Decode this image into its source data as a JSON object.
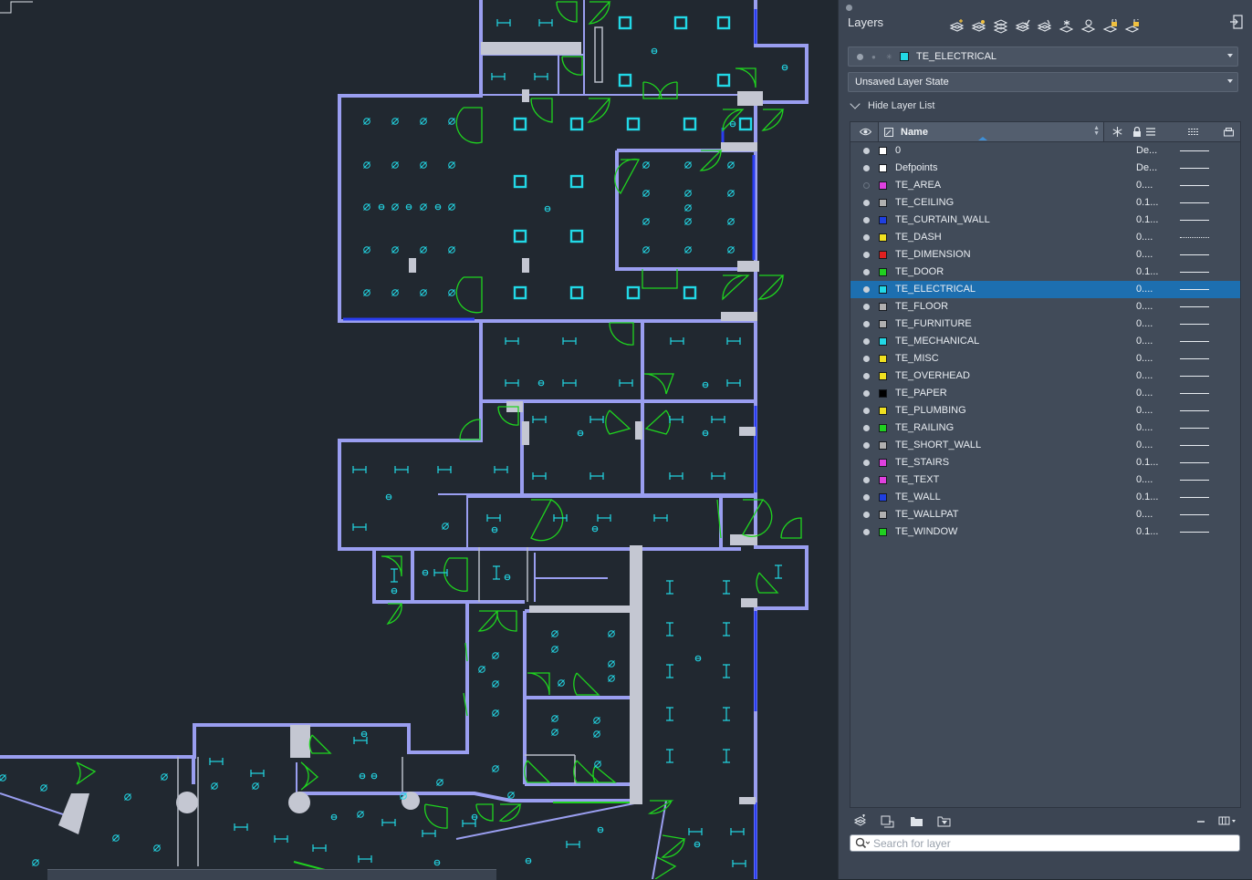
{
  "panel": {
    "title": "Layers",
    "current_layer": {
      "name": "TE_ELECTRICAL",
      "color": "#22d8e6"
    },
    "layer_state": "Unsaved Layer State",
    "hide_list_label": "Hide Layer List",
    "column_name": "Name",
    "search_placeholder": "Search for layer"
  },
  "layers": [
    {
      "name": "0",
      "color": "#ffffff",
      "lineweight": "De...",
      "on": true,
      "linetype": "solid",
      "selected": false
    },
    {
      "name": "Defpoints",
      "color": "#ffffff",
      "lineweight": "De...",
      "on": true,
      "linetype": "solid",
      "selected": false
    },
    {
      "name": "TE_AREA",
      "color": "#e040e0",
      "lineweight": "0....",
      "on": false,
      "linetype": "solid",
      "selected": false
    },
    {
      "name": "TE_CEILING",
      "color": "#b0b0b0",
      "lineweight": "0.1...",
      "on": true,
      "linetype": "solid",
      "selected": false
    },
    {
      "name": "TE_CURTAIN_WALL",
      "color": "#1f3fe0",
      "lineweight": "0.1...",
      "on": true,
      "linetype": "solid",
      "selected": false
    },
    {
      "name": "TE_DASH",
      "color": "#f0e020",
      "lineweight": "0....",
      "on": true,
      "linetype": "dashed",
      "selected": false
    },
    {
      "name": "TE_DIMENSION",
      "color": "#e02020",
      "lineweight": "0....",
      "on": true,
      "linetype": "solid",
      "selected": false
    },
    {
      "name": "TE_DOOR",
      "color": "#20d020",
      "lineweight": "0.1...",
      "on": true,
      "linetype": "solid",
      "selected": false
    },
    {
      "name": "TE_ELECTRICAL",
      "color": "#22d8e6",
      "lineweight": "0....",
      "on": true,
      "linetype": "solid",
      "selected": true
    },
    {
      "name": "TE_FLOOR",
      "color": "#b0b0b0",
      "lineweight": "0....",
      "on": true,
      "linetype": "solid",
      "selected": false
    },
    {
      "name": "TE_FURNITURE",
      "color": "#b0b0b0",
      "lineweight": "0....",
      "on": true,
      "linetype": "solid",
      "selected": false
    },
    {
      "name": "TE_MECHANICAL",
      "color": "#22d8e6",
      "lineweight": "0....",
      "on": true,
      "linetype": "solid",
      "selected": false
    },
    {
      "name": "TE_MISC",
      "color": "#f0e020",
      "lineweight": "0....",
      "on": true,
      "linetype": "solid",
      "selected": false
    },
    {
      "name": "TE_OVERHEAD",
      "color": "#f0e020",
      "lineweight": "0....",
      "on": true,
      "linetype": "solid",
      "selected": false
    },
    {
      "name": "TE_PAPER",
      "color": "#000000",
      "lineweight": "0....",
      "on": true,
      "linetype": "solid",
      "selected": false
    },
    {
      "name": "TE_PLUMBING",
      "color": "#f0e020",
      "lineweight": "0....",
      "on": true,
      "linetype": "solid",
      "selected": false
    },
    {
      "name": "TE_RAILING",
      "color": "#20d020",
      "lineweight": "0....",
      "on": true,
      "linetype": "solid",
      "selected": false
    },
    {
      "name": "TE_SHORT_WALL",
      "color": "#b0b0b0",
      "lineweight": "0....",
      "on": true,
      "linetype": "solid",
      "selected": false
    },
    {
      "name": "TE_STAIRS",
      "color": "#e040e0",
      "lineweight": "0.1...",
      "on": true,
      "linetype": "solid",
      "selected": false
    },
    {
      "name": "TE_TEXT",
      "color": "#e040e0",
      "lineweight": "0....",
      "on": true,
      "linetype": "solid",
      "selected": false
    },
    {
      "name": "TE_WALL",
      "color": "#1f3fe0",
      "lineweight": "0.1...",
      "on": true,
      "linetype": "solid",
      "selected": false
    },
    {
      "name": "TE_WALLPAT",
      "color": "#b0b0b0",
      "lineweight": "0....",
      "on": true,
      "linetype": "solid",
      "selected": false
    },
    {
      "name": "TE_WINDOW",
      "color": "#20d020",
      "lineweight": "0.1...",
      "on": true,
      "linetype": "solid",
      "selected": false
    }
  ],
  "icons": {
    "toolbar": [
      "new-layer-icon",
      "new-layer-vp-frozen-icon",
      "delete-layer-icon",
      "set-current-icon",
      "layer-match-icon",
      "freeze-icon",
      "isolate-icon",
      "lock-icon",
      "unlock-icon"
    ],
    "bottom": [
      "new-layer-icon",
      "new-group-icon",
      "open-folder-icon",
      "filter-folder-icon",
      "collapse-icon",
      "columns-icon"
    ]
  }
}
